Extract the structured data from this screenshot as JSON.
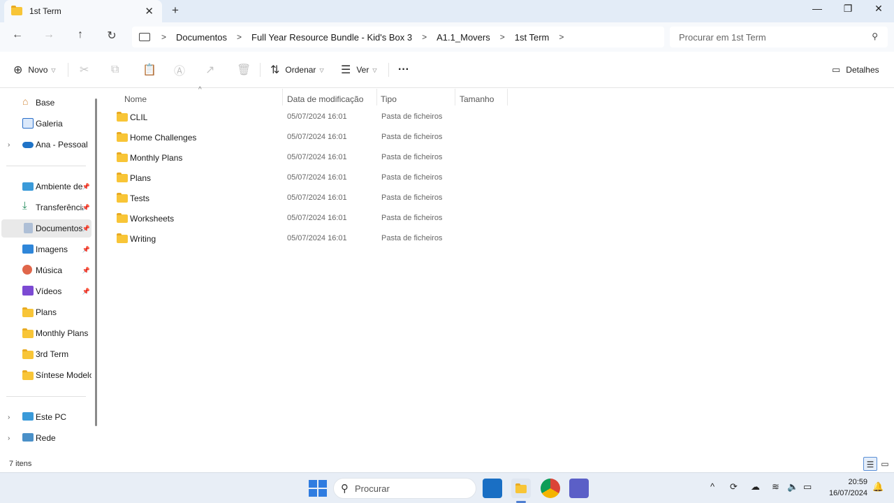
{
  "tab": {
    "title": "1st Term",
    "close": "✕",
    "new": "+"
  },
  "window_controls": {
    "minimize": "—",
    "maximize": "❐",
    "close": "✕"
  },
  "nav": {
    "back": "←",
    "forward": "→",
    "up": "↑",
    "refresh": "↻"
  },
  "breadcrumb": [
    "Documentos",
    "Full Year Resource Bundle - Kid's Box 3",
    "A1.1_Movers",
    "1st Term"
  ],
  "breadcrumb_sep": ">",
  "search": {
    "placeholder": "Procurar em 1st Term"
  },
  "commands": {
    "new": "Novo",
    "sort": "Ordenar",
    "view": "Ver",
    "more": "···",
    "details": "Detalhes"
  },
  "sidebar": {
    "top": [
      {
        "label": "Base",
        "icon": "home-icon"
      },
      {
        "label": "Galeria",
        "icon": "gallery-icon"
      },
      {
        "label": "Ana - Pessoal",
        "icon": "onedrive-icon",
        "expandable": true
      }
    ],
    "pinned": [
      {
        "label": "Ambiente de Trabalho",
        "icon": "desktop-icon",
        "pinned": true
      },
      {
        "label": "Transferências",
        "icon": "download-icon",
        "pinned": true
      },
      {
        "label": "Documentos",
        "icon": "documents-icon",
        "pinned": true,
        "selected": true
      },
      {
        "label": "Imagens",
        "icon": "pictures-icon",
        "pinned": true
      },
      {
        "label": "Música",
        "icon": "music-icon",
        "pinned": true
      },
      {
        "label": "Vídeos",
        "icon": "videos-icon",
        "pinned": true
      },
      {
        "label": "Plans",
        "icon": "folder-icon"
      },
      {
        "label": "Monthly Plans",
        "icon": "folder-icon"
      },
      {
        "label": "3rd Term",
        "icon": "folder-icon"
      },
      {
        "label": "Síntese Modelo",
        "icon": "folder-icon"
      }
    ],
    "bottom": [
      {
        "label": "Este PC",
        "icon": "pc-icon",
        "expandable": true
      },
      {
        "label": "Rede",
        "icon": "network-icon",
        "expandable": true
      }
    ]
  },
  "columns": {
    "name": "Nome",
    "date": "Data de modificação",
    "type": "Tipo",
    "size": "Tamanho"
  },
  "files": [
    {
      "name": "CLIL",
      "date": "05/07/2024 16:01",
      "type": "Pasta de ficheiros"
    },
    {
      "name": "Home Challenges",
      "date": "05/07/2024 16:01",
      "type": "Pasta de ficheiros"
    },
    {
      "name": "Monthly Plans",
      "date": "05/07/2024 16:01",
      "type": "Pasta de ficheiros"
    },
    {
      "name": "Plans",
      "date": "05/07/2024 16:01",
      "type": "Pasta de ficheiros"
    },
    {
      "name": "Tests",
      "date": "05/07/2024 16:01",
      "type": "Pasta de ficheiros"
    },
    {
      "name": "Worksheets",
      "date": "05/07/2024 16:01",
      "type": "Pasta de ficheiros"
    },
    {
      "name": "Writing",
      "date": "05/07/2024 16:01",
      "type": "Pasta de ficheiros"
    }
  ],
  "status": {
    "count": "7 itens"
  },
  "taskbar": {
    "search_label": "Procurar",
    "time": "20:59",
    "date": "16/07/2024"
  },
  "colors": {
    "accent": "#4f7fd1",
    "folder": "#f8c537",
    "selected_bg": "#e9e9e9"
  }
}
